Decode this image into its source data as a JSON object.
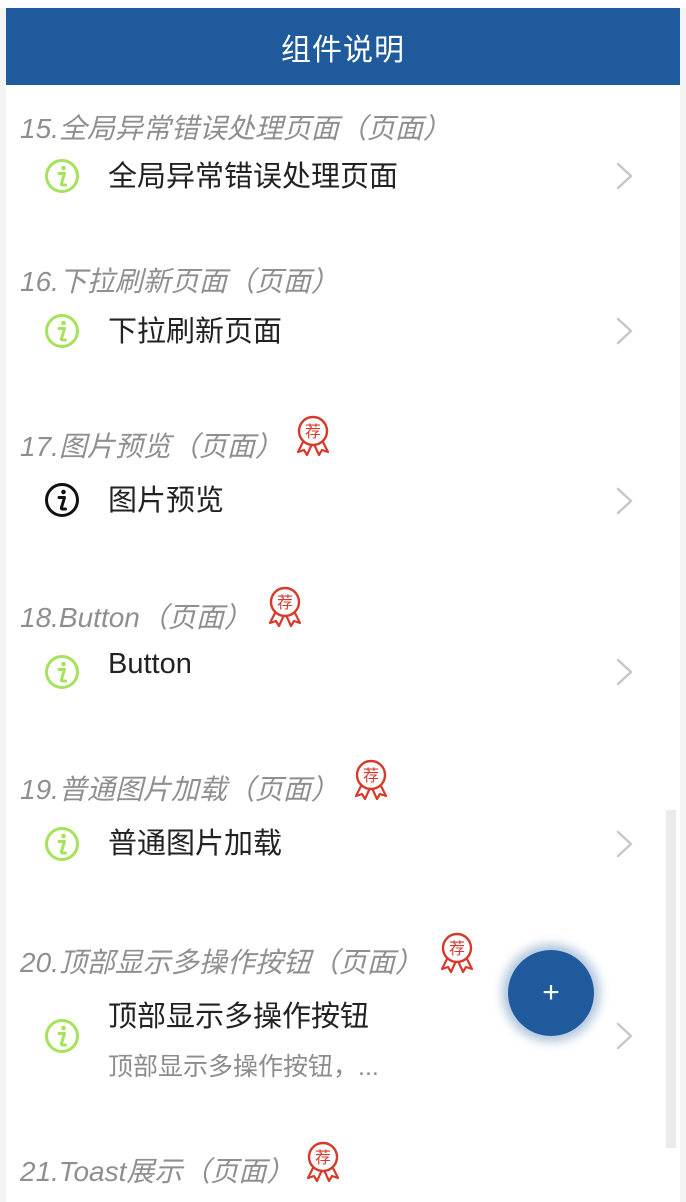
{
  "header": {
    "title": "组件说明"
  },
  "fab": {
    "label": "+"
  },
  "colors": {
    "header_bg": "#1f5a9c",
    "info_icon": "#a5e35a",
    "info_icon_active": "#111111",
    "badge": "#d63a2b",
    "fab_bg": "#1f5a9c"
  },
  "items": [
    {
      "section": "15.全局异常错误处理页面（页面）",
      "label": "全局异常错误处理页面",
      "icon": "info-icon",
      "recommended": false,
      "subtitle": ""
    },
    {
      "section": "16.下拉刷新页面（页面）",
      "label": "下拉刷新页面",
      "icon": "info-icon",
      "recommended": false,
      "subtitle": ""
    },
    {
      "section": "17.图片预览（页面）",
      "label": "图片预览",
      "icon": "info-icon",
      "icon_active": true,
      "recommended": true,
      "badge_text": "荐",
      "subtitle": ""
    },
    {
      "section": "18.Button（页面）",
      "label": "Button",
      "icon": "info-icon",
      "recommended": true,
      "badge_text": "荐",
      "subtitle": ""
    },
    {
      "section": "19.普通图片加载（页面）",
      "label": "普通图片加载",
      "icon": "info-icon",
      "recommended": true,
      "badge_text": "荐",
      "subtitle": ""
    },
    {
      "section": "20.顶部显示多操作按钮（页面）",
      "label": "顶部显示多操作按钮",
      "icon": "info-icon",
      "recommended": true,
      "badge_text": "荐",
      "subtitle": "顶部显示多操作按钮，..."
    },
    {
      "section": "21.Toast展示（页面）",
      "label": "",
      "icon": "",
      "recommended": true,
      "badge_text": "荐",
      "subtitle": ""
    }
  ]
}
